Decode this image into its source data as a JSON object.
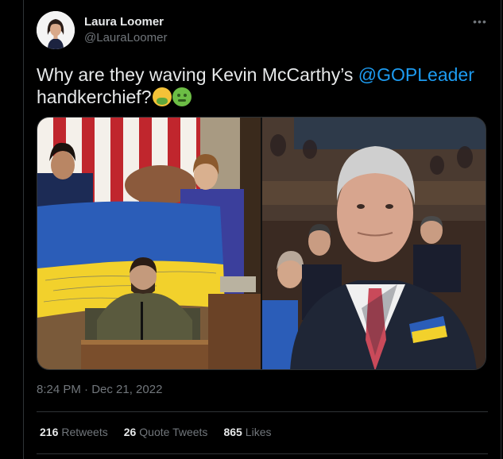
{
  "tweet": {
    "display_name": "Laura Loomer",
    "handle": "@LauraLoomer",
    "more_icon": "ellipsis-icon",
    "text_before": "Why are they waving Kevin McCarthy’s ",
    "mention": "@GOPLeader",
    "text_after": " handkerchief?",
    "emojis": [
      "face-vomiting-emoji",
      "nauseated-face-emoji"
    ],
    "timestamp": "8:24 PM · Dec 21, 2022"
  },
  "stats": {
    "retweets_count": "216",
    "retweets_label": "Retweets",
    "quotes_count": "26",
    "quotes_label": "Quote Tweets",
    "likes_count": "865",
    "likes_label": "Likes"
  },
  "colors": {
    "background": "#000000",
    "text": "#e7e9ea",
    "muted": "#71767b",
    "link": "#1d9bf0",
    "border": "#2f3336",
    "ukraine_blue": "#2b5db8",
    "ukraine_yellow": "#f2d12c"
  }
}
